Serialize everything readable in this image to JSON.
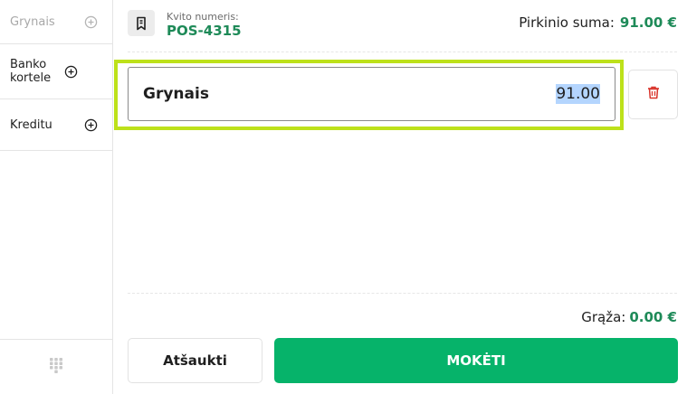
{
  "sidebar": {
    "items": [
      {
        "label": "Grynais",
        "icon": "plus-circle-icon",
        "disabled": true
      },
      {
        "label": "Banko kortele",
        "icon": "plus-circle-icon",
        "disabled": false
      },
      {
        "label": "Kreditu",
        "icon": "plus-circle-icon",
        "disabled": false
      }
    ],
    "footer_icon": "keypad-icon"
  },
  "header": {
    "receipt_icon": "bookmark-icon",
    "receipt_label": "Kvito numeris:",
    "receipt_number": "POS-4315",
    "total_label": "Pirkinio suma:",
    "total_value": "91.00 €"
  },
  "payments": [
    {
      "name": "Grynais",
      "amount": "91.00"
    }
  ],
  "change": {
    "label": "Grąža:",
    "value": "0.00 €"
  },
  "buttons": {
    "cancel_label": "Atšaukti",
    "pay_label": "MOKĖTI"
  },
  "colors": {
    "accent_green": "#1e8a58",
    "pay_button": "#06b36a",
    "highlight": "#bde11a",
    "delete_icon": "#d9342b",
    "selection": "#b4d5fe"
  }
}
